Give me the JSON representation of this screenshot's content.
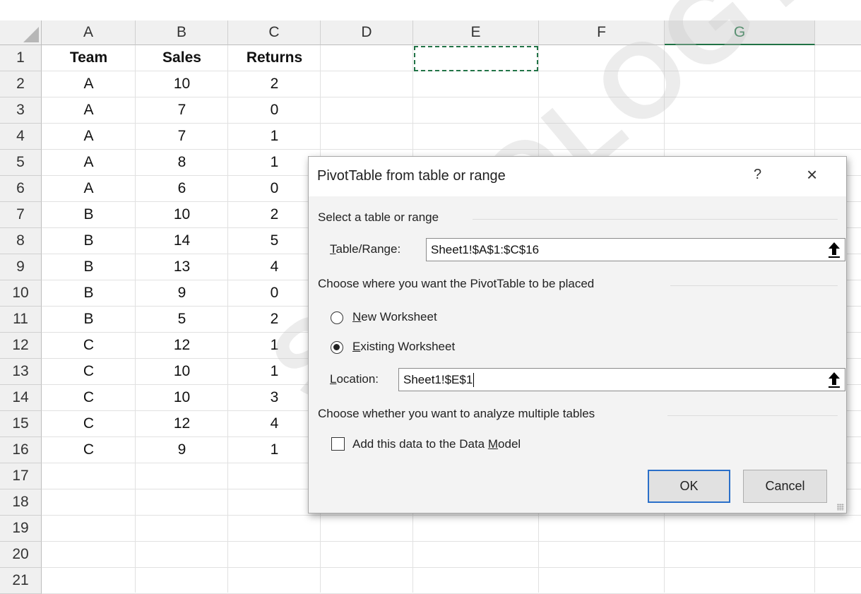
{
  "columns": [
    "A",
    "B",
    "C",
    "D",
    "E",
    "F",
    "G"
  ],
  "selected_column": "G",
  "row_numbers": [
    "1",
    "2",
    "3",
    "4",
    "5",
    "6",
    "7",
    "8",
    "9",
    "10",
    "11",
    "12",
    "13",
    "14",
    "15",
    "16",
    "17",
    "18",
    "19",
    "20",
    "21"
  ],
  "header_row": [
    "Team",
    "Sales",
    "Returns"
  ],
  "rows": [
    [
      "A",
      "10",
      "2"
    ],
    [
      "A",
      "7",
      "0"
    ],
    [
      "A",
      "7",
      "1"
    ],
    [
      "A",
      "8",
      "1"
    ],
    [
      "A",
      "6",
      "0"
    ],
    [
      "B",
      "10",
      "2"
    ],
    [
      "B",
      "14",
      "5"
    ],
    [
      "B",
      "13",
      "4"
    ],
    [
      "B",
      "9",
      "0"
    ],
    [
      "B",
      "5",
      "2"
    ],
    [
      "C",
      "12",
      "1"
    ],
    [
      "C",
      "10",
      "1"
    ],
    [
      "C",
      "10",
      "3"
    ],
    [
      "C",
      "12",
      "4"
    ],
    [
      "C",
      "9",
      "1"
    ]
  ],
  "dialog": {
    "title": "PivotTable from table or range",
    "help_glyph": "?",
    "close_glyph": "×",
    "group_select": "Select a table or range",
    "table_range_label": "Table/Range:",
    "table_range_value": "Sheet1!$A$1:$C$16",
    "group_place": "Choose where you want the PivotTable to be placed",
    "new_worksheet": "New Worksheet",
    "existing_worksheet": "Existing Worksheet",
    "selected_option": "existing",
    "location_label": "Location:",
    "location_value": "Sheet1!$E$1",
    "group_multi": "Choose whether you want to analyze multiple tables",
    "data_model_label": "Add this data to the Data Model",
    "data_model_checked": false,
    "ok_label": "OK",
    "cancel_label": "Cancel"
  },
  "watermark": "STATOLOGY.COM",
  "colors": {
    "accent": "#217346",
    "default_button_border": "#2a6fc9"
  },
  "icons": [
    "collapse-dialog-arrow-icon",
    "resize-grip-icon",
    "close-icon",
    "help-icon"
  ]
}
